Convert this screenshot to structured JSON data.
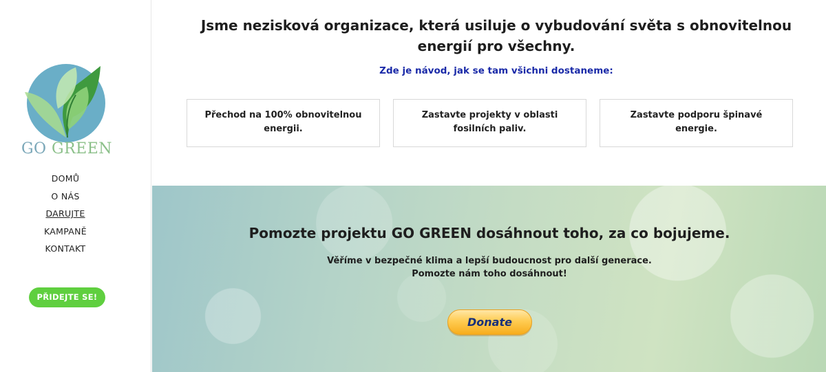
{
  "brand": {
    "name_part1": "GO ",
    "name_part2": "GREEN",
    "colors": {
      "blue": "#6aaec7",
      "leaf_light": "#a8dc8e",
      "leaf_dark": "#3f9a3f",
      "join_button": "#5fcf3f"
    }
  },
  "nav": {
    "items": [
      {
        "label": "DOMŮ"
      },
      {
        "label": "O NÁS"
      },
      {
        "label": "DARUJTE",
        "active": true
      },
      {
        "label": "KAMPANĚ"
      },
      {
        "label": "KONTAKT"
      }
    ],
    "join_label": "PŘIDEJTE SE!"
  },
  "intro": {
    "headline": "Jsme nezisková organizace, která usiluje o vybudování světa s obnovitelnou energií pro všechny.",
    "subhead": "Zde je návod, jak se tam všichni dostaneme:",
    "subhead_color": "#1a2aa8"
  },
  "cards": [
    {
      "text": "Přechod na 100% obnovitelnou energii."
    },
    {
      "text": "Zastavte projekty v oblasti fosilních paliv."
    },
    {
      "text": "Zastavte podporu špinavé energie."
    }
  ],
  "hero": {
    "title": "Pomozte projektu GO GREEN dosáhnout toho, za co bojujeme.",
    "line1": "Věříme v bezpečné klima a lepší budoucnost pro další generace.",
    "line2": "Pomozte nám toho dosáhnout!",
    "donate_label": "Donate"
  }
}
